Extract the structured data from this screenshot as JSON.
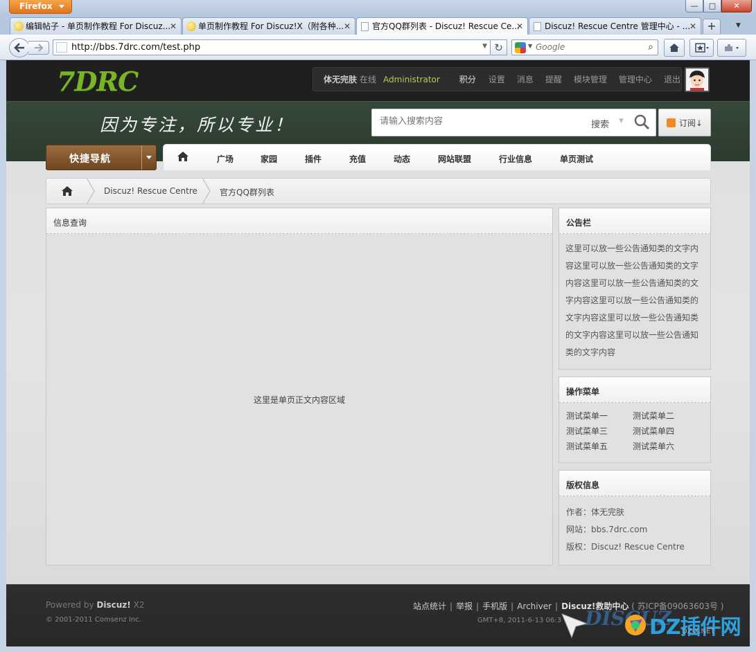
{
  "browser": {
    "app_button": "Firefox",
    "tabs": [
      {
        "title": "编辑帖子 - 单页制作教程 For Discuz..."
      },
      {
        "title": "单页制作教程 For Discuz!X（附各种..."
      },
      {
        "title": "官方QQ群列表 - Discuz! Rescue Ce..."
      },
      {
        "title": "Discuz! Rescue Centre 管理中心 - ..."
      }
    ],
    "url": "http://bbs.7drc.com/test.php",
    "search_engine_placeholder": "Google"
  },
  "header": {
    "logo": "7DRC",
    "user": {
      "name": "体无完肤",
      "status": "在线",
      "group": "Administrator",
      "points_label": "积分",
      "links": [
        "设置",
        "消息",
        "提醒",
        "模块管理",
        "管理中心",
        "退出"
      ]
    },
    "slogan": "因为专注，所以专业！",
    "search": {
      "placeholder": "请输入搜索内容",
      "type_label": "搜索"
    },
    "subscribe_label": "订阅↓"
  },
  "nav": {
    "quick_nav_label": "快捷导航",
    "items": [
      "广场",
      "家园",
      "插件",
      "充值",
      "动态",
      "网站联盟",
      "行业信息",
      "单页测试"
    ]
  },
  "breadcrumb": [
    "Discuz! Rescue Centre",
    "官方QQ群列表"
  ],
  "main": {
    "title": "信息查询",
    "body": "这里是单页正文内容区域"
  },
  "sidebar": {
    "notice": {
      "title": "公告栏",
      "text": "这里可以放一些公告通知类的文字内容这里可以放一些公告通知类的文字内容这里可以放一些公告通知类的文字内容这里可以放一些公告通知类的文字内容这里可以放一些公告通知类的文字内容这里可以放一些公告通知类的文字内容"
    },
    "menu": {
      "title": "操作菜单",
      "items": [
        "测试菜单一",
        "测试菜单二",
        "测试菜单三",
        "测试菜单四",
        "测试菜单五",
        "测试菜单六"
      ]
    },
    "copyright": {
      "title": "版权信息",
      "lines": [
        "作者：体无完肤",
        "网站：bbs.7drc.com",
        "版权：Discuz! Rescue Centre"
      ]
    }
  },
  "footer": {
    "powered_prefix": "Powered by",
    "powered_brand": "Discuz!",
    "powered_version": "X2",
    "copyright": "© 2001-2011 Comsenz Inc.",
    "links": [
      "站点统计",
      "举报",
      "手机版",
      "Archiver"
    ],
    "help_center": "Discuz!救助中心",
    "icp": "( 苏ICP备09063603号 )",
    "time": "GMT+8, 2011-6-13 06:3"
  },
  "watermark": {
    "text1": "DISCUZ",
    "text2": "DZ插件网",
    "text3": "DZ-X.NET"
  }
}
